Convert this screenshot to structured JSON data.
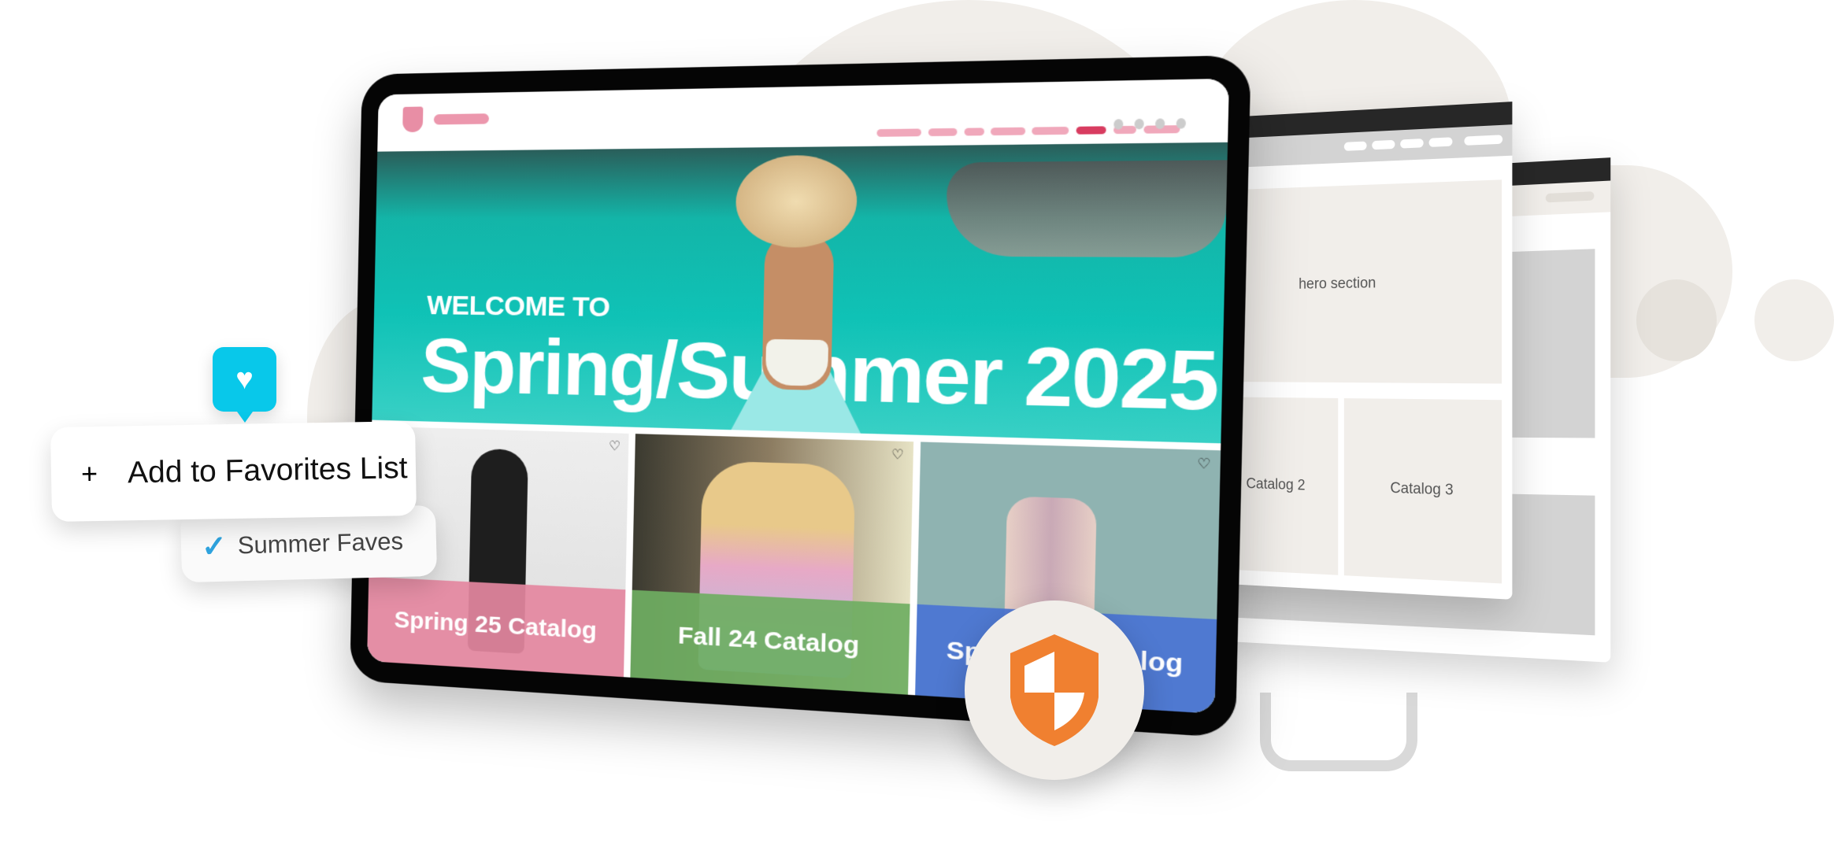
{
  "tablet": {
    "hero": {
      "welcome": "WELCOME TO",
      "title": "Spring/Summer 2025"
    },
    "catalogs": [
      {
        "label": "Spring 25 Catalog",
        "color": "#e4879f"
      },
      {
        "label": "Fall 24 Catalog",
        "color": "#6fae62"
      },
      {
        "label": "Spring 24 Catalog",
        "color": "#4a74d4"
      }
    ],
    "heart_icon": "heart-outline-icon"
  },
  "wireframe": {
    "hero": "hero section",
    "catalog2": "Catalog 2",
    "catalog3": "Catalog 3"
  },
  "favorites": {
    "add_label": "Add to Favorites List",
    "plus": "+",
    "list_name": "Summer Faves",
    "accent": "#08c8ea",
    "check_color": "#2fa3de"
  },
  "shield": {
    "color": "#f08030"
  }
}
